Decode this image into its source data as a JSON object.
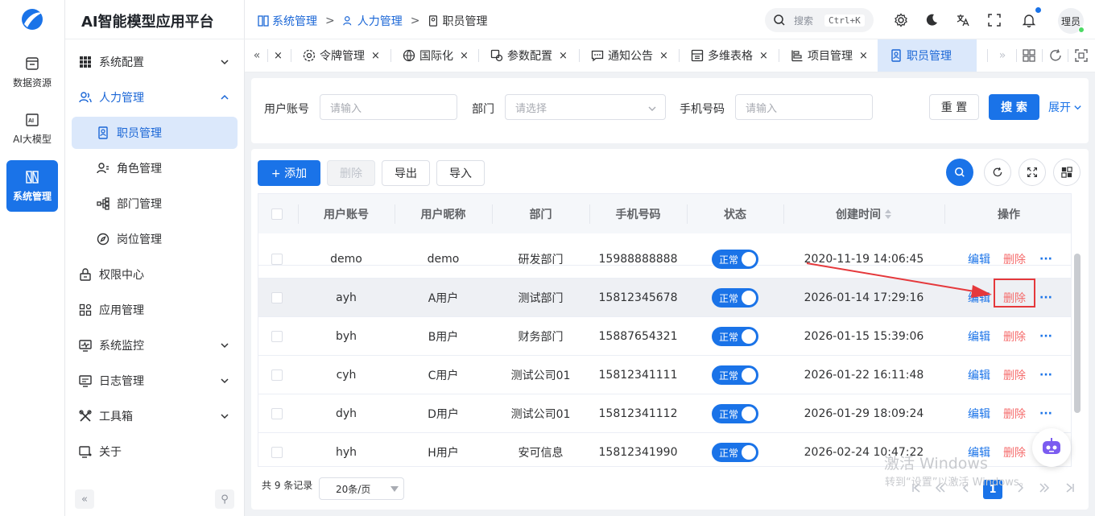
{
  "rail": {
    "items": [
      {
        "label": "数据资源",
        "icon": "database-icon"
      },
      {
        "label": "AI大模型",
        "icon": "ai-chip-icon"
      },
      {
        "label": "系统管理",
        "icon": "grid-icon"
      }
    ]
  },
  "menu": {
    "title": "AI智能模型应用平台",
    "items": [
      {
        "label": "系统配置"
      },
      {
        "label": "人力管理"
      },
      {
        "label": "职员管理"
      },
      {
        "label": "角色管理"
      },
      {
        "label": "部门管理"
      },
      {
        "label": "岗位管理"
      },
      {
        "label": "权限中心"
      },
      {
        "label": "应用管理"
      },
      {
        "label": "系统监控"
      },
      {
        "label": "日志管理"
      },
      {
        "label": "工具箱"
      },
      {
        "label": "关于"
      }
    ],
    "collapse_glyph": "«",
    "pin_glyph": "⚲"
  },
  "header": {
    "breadcrumb": [
      "系统管理",
      "人力管理",
      "职员管理"
    ],
    "search_placeholder": "搜索",
    "search_shortcut": "Ctrl+K",
    "avatar_text": "理员"
  },
  "tabs": {
    "scroll_left": "«",
    "first_close": "×",
    "items": [
      {
        "label": "令牌管理",
        "icon": "gear-icon"
      },
      {
        "label": "国际化",
        "icon": "globe-icon"
      },
      {
        "label": "参数配置",
        "icon": "settings-icon"
      },
      {
        "label": "通知公告",
        "icon": "message-icon"
      },
      {
        "label": "多维表格",
        "icon": "table-icon"
      },
      {
        "label": "项目管理",
        "icon": "project-icon"
      },
      {
        "label": "职员管理",
        "icon": "user-doc-icon"
      }
    ],
    "close": "×",
    "scroll_right": "»"
  },
  "filter": {
    "account_label": "用户账号",
    "account_placeholder": "请输入",
    "dept_label": "部门",
    "dept_placeholder": "请选择",
    "phone_label": "手机号码",
    "phone_placeholder": "请输入",
    "reset": "重 置",
    "search": "搜 索",
    "expand": "展开"
  },
  "toolbar": {
    "add": "+ 添加",
    "delete": "删除",
    "export": "导出",
    "import": "导入"
  },
  "table": {
    "columns": [
      "用户账号",
      "用户昵称",
      "部门",
      "手机号码",
      "状态",
      "创建时间",
      "操作"
    ],
    "rows": [
      {
        "account": "demo",
        "nickname": "demo",
        "dept": "研发部门",
        "phone": "15988888888",
        "status": "正常",
        "created": "2020-11-19 14:06:45"
      },
      {
        "account": "ayh",
        "nickname": "A用户",
        "dept": "测试部门",
        "phone": "15812345678",
        "status": "正常",
        "created": "2026-01-14 17:29:16"
      },
      {
        "account": "byh",
        "nickname": "B用户",
        "dept": "财务部门",
        "phone": "15887654321",
        "status": "正常",
        "created": "2026-01-15 15:39:06"
      },
      {
        "account": "cyh",
        "nickname": "C用户",
        "dept": "测试公司01",
        "phone": "15812341111",
        "status": "正常",
        "created": "2026-01-22 16:11:48"
      },
      {
        "account": "dyh",
        "nickname": "D用户",
        "dept": "测试公司01",
        "phone": "15812341112",
        "status": "正常",
        "created": "2026-01-29 18:09:24"
      },
      {
        "account": "hyh",
        "nickname": "H用户",
        "dept": "安可信息",
        "phone": "15812341990",
        "status": "正常",
        "created": "2026-02-24 10:47:22"
      }
    ],
    "edit_label": "编辑",
    "delete_label": "删除",
    "more_label": "···"
  },
  "pagination": {
    "total_text": "共 9 条记录",
    "page_size": "20条/页",
    "current_page": "1"
  },
  "watermark": {
    "line1": "激活 Windows",
    "line2": "转到“设置”以激活 Windows。"
  },
  "colors": {
    "primary": "#1a73e8",
    "danger": "#f56c6c",
    "highlight_box": "#e5383b",
    "annotation_arrow": "#e5383b"
  }
}
